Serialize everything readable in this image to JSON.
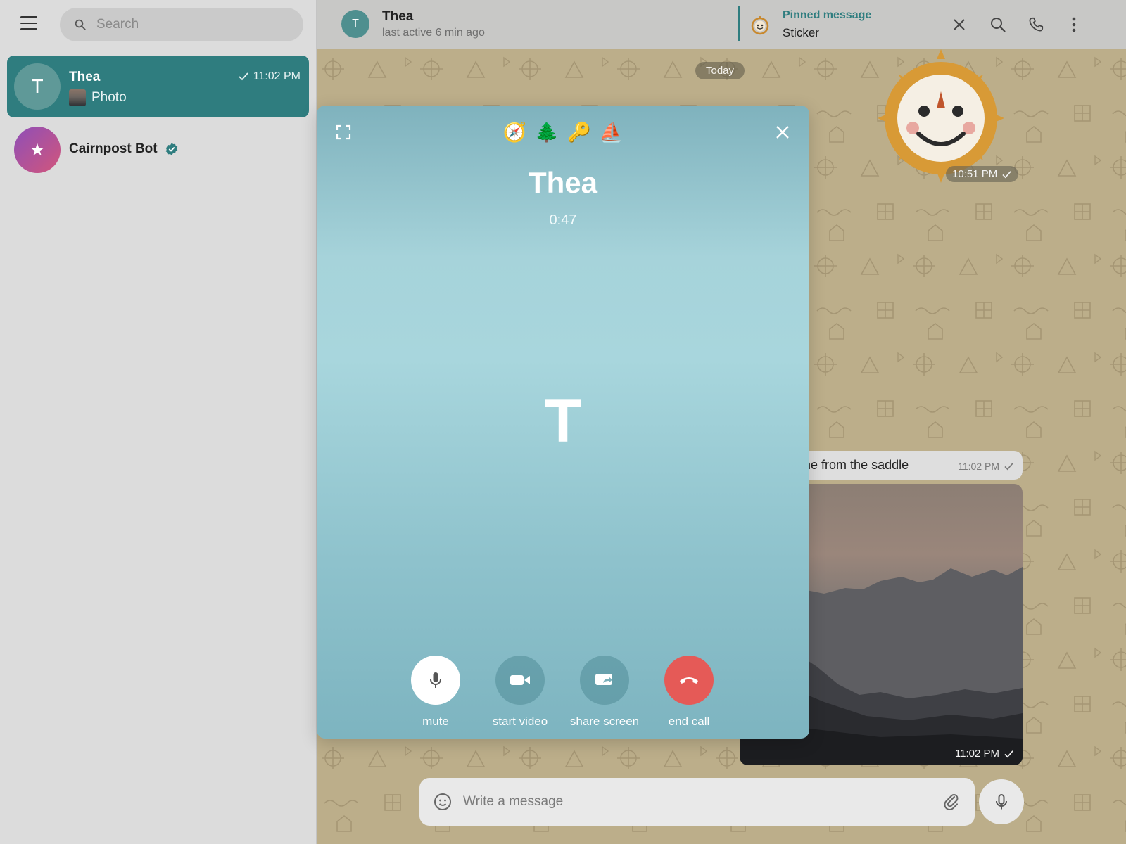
{
  "sidebar": {
    "search_placeholder": "Search",
    "chats": [
      {
        "avatar_letter": "T",
        "name": "Thea",
        "time": "11:02 PM",
        "preview": "Photo"
      },
      {
        "avatar_letter": "★",
        "name": "Cairnpost Bot"
      }
    ]
  },
  "header": {
    "avatar_letter": "T",
    "name": "Thea",
    "status": "last active 6 min ago",
    "pinned_title": "Pinned message",
    "pinned_text": "Sticker"
  },
  "messages": {
    "date_label": "Today",
    "sticker_time": "10:51 PM",
    "text": "he one from the saddle",
    "text_time": "11:02 PM",
    "photo_time": "11:02 PM"
  },
  "composer": {
    "placeholder": "Write a message"
  },
  "call": {
    "emojis": [
      "🧭",
      "🌲",
      "🔑",
      "⛵"
    ],
    "name": "Thea",
    "timer": "0:47",
    "avatar_letter": "T",
    "controls": {
      "mute": "mute",
      "video": "start video",
      "share": "share screen",
      "end": "end call"
    }
  },
  "colors": {
    "accent": "#2f7d7f",
    "end_call": "#e55a57",
    "chat_bg": "#bcae8a"
  }
}
